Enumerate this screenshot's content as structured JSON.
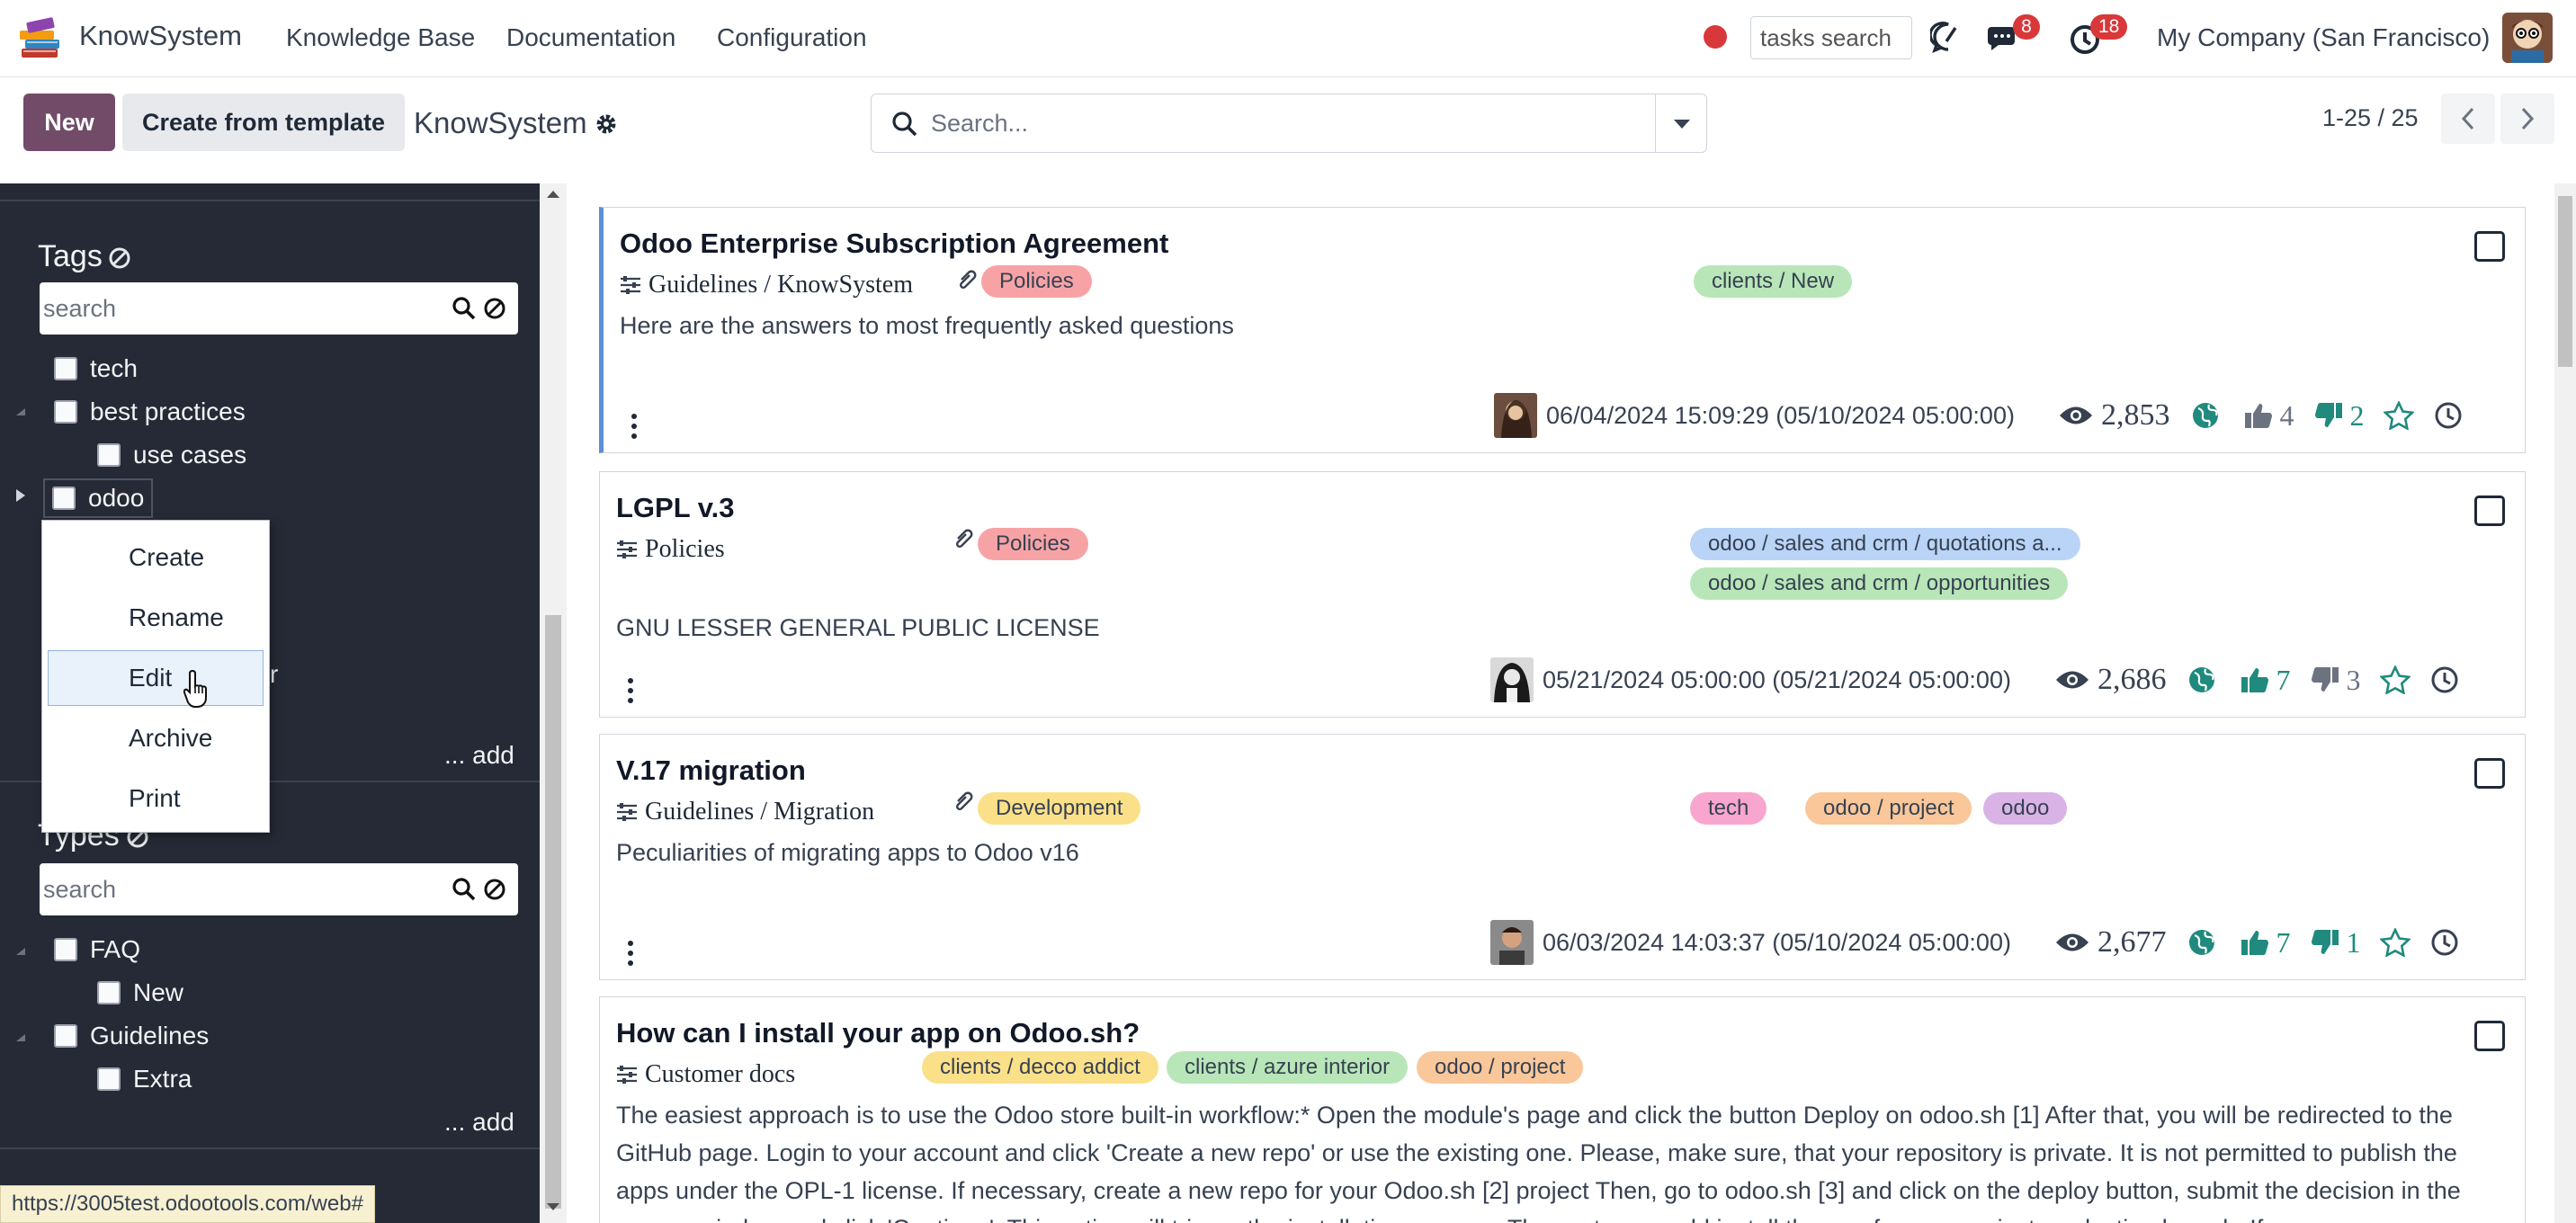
{
  "navbar": {
    "brand": "KnowSystem",
    "menus": [
      "Knowledge Base",
      "Documentation",
      "Configuration"
    ],
    "tasks_search_placeholder": "tasks search",
    "messages_badge": "8",
    "activities_badge": "18",
    "company": "My Company (San Francisco)"
  },
  "control_panel": {
    "new_label": "New",
    "template_label": "Create from template",
    "breadcrumb": "KnowSystem",
    "search_placeholder": "Search...",
    "pager": "1-25 / 25"
  },
  "sidebar": {
    "tags_title": "Tags",
    "tags_search_placeholder": "search",
    "tags": [
      "tech",
      "best practices",
      "use cases",
      "odoo"
    ],
    "tags_partial_item": "r",
    "add_label": "... add",
    "types_title": "Types",
    "types_search_placeholder": "search",
    "types": [
      "FAQ",
      "New",
      "Guidelines",
      "Extra"
    ],
    "types_add_label": "... add"
  },
  "context_menu": {
    "items": [
      "Create",
      "Rename",
      "Edit",
      "Archive",
      "Print"
    ]
  },
  "articles": [
    {
      "title": "Odoo Enterprise Subscription Agreement",
      "path": "Guidelines / KnowSystem",
      "section_tag": "Policies",
      "tags": [
        "clients / New"
      ],
      "description": "Here are the answers to most frequently asked questions",
      "date": "06/04/2024 15:09:29 (05/10/2024 05:00:00)",
      "views": "2,853",
      "likes": "4",
      "dislikes": "2"
    },
    {
      "title": "LGPL v.3",
      "path": "Policies",
      "section_tag": "Policies",
      "tags": [
        "odoo / sales and crm / quotations a...",
        "odoo / sales and crm / opportunities"
      ],
      "description": "GNU LESSER GENERAL PUBLIC LICENSE",
      "date": "05/21/2024 05:00:00 (05/21/2024 05:00:00)",
      "views": "2,686",
      "likes": "7",
      "dislikes": "3"
    },
    {
      "title": "V.17 migration",
      "path": "Guidelines / Migration",
      "section_tag": "Development",
      "tags": [
        "tech",
        "odoo / project",
        "odoo"
      ],
      "description": "Peculiarities of migrating apps to Odoo v16",
      "date": "06/03/2024 14:03:37 (05/10/2024 05:00:00)",
      "views": "2,677",
      "likes": "7",
      "dislikes": "1"
    },
    {
      "title": "How can I install your app on Odoo.sh?",
      "path": "Customer docs",
      "tags": [
        "clients / decco addict",
        "clients / azure interior",
        "odoo / project"
      ],
      "description": "The easiest approach is to use the Odoo store built-in workflow:* Open the module's page and click the button Deploy on odoo.sh [1] After that, you will be redirected to the GitHub page. Login to your account and click 'Create a new repo' or use the existing one. Please, make sure, that your repository is private. It is not permitted to publish the apps under the OPL-1 license. If necessary, create a new repo for your Odoo.sh [2] project Then, go to odoo.sh [3] and click on the deploy button, submit the decision in the pop-up window and click 'Continue'. This action will trigger the installation process. These steps would install the app for your project production branch. If"
    }
  ],
  "status_url": "https://3005test.odootools.com/web#",
  "colors": {
    "primary": "#714b67",
    "sidebar": "#262a36",
    "tag_red": "#f7a3a6",
    "tag_green": "#b8e6b8",
    "tag_blue": "#b9d4f7",
    "tag_yellow": "#fbe08a",
    "tag_pink": "#f8a6cf",
    "tag_orange": "#f9c79a",
    "tag_purple": "#d9b3e6",
    "accent_icon": "#1f8a7d"
  }
}
